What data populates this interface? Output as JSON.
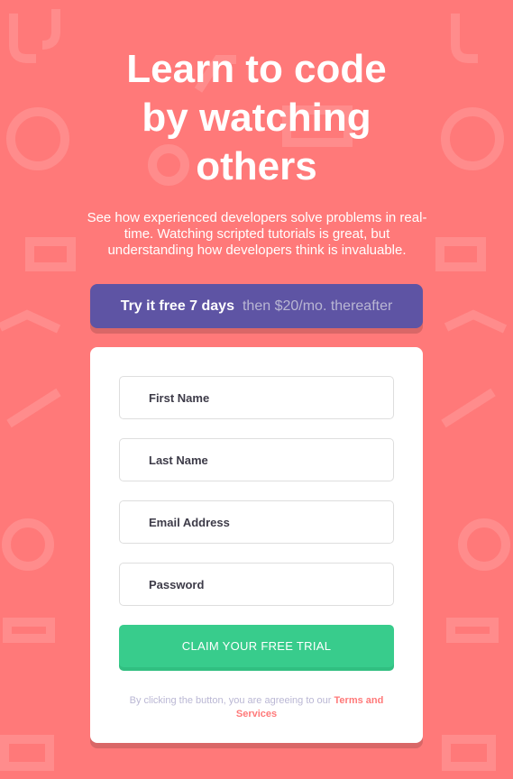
{
  "hero": {
    "title_lines": [
      "Learn to code",
      "by watching",
      "others"
    ],
    "subtitle": "See how experienced developers solve problems in real-time. Watching scripted tutorials is great, but understanding how developers think is invaluable."
  },
  "trial_banner": {
    "strong_text": "Try it free 7 days",
    "price_text": "then $20/mo. thereafter"
  },
  "form": {
    "fields": [
      {
        "label": "First Name"
      },
      {
        "label": "Last Name"
      },
      {
        "label": "Email Address"
      },
      {
        "label": "Password"
      }
    ],
    "submit_label": "CLAIM YOUR FREE TRIAL",
    "terms_prefix": "By clicking the button, you are agreeing to our",
    "terms_link": "Terms and Services"
  },
  "colors": {
    "background": "#ff7979",
    "banner": "#5e54a4",
    "button": "#38cc8c",
    "text_dark": "#3d3b48"
  }
}
